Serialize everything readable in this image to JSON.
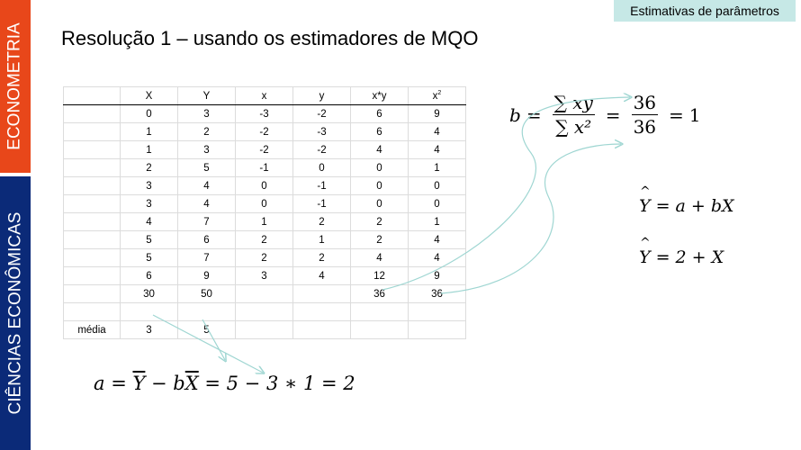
{
  "sidebar": {
    "top_label": "ECONOMETRIA",
    "bottom_label": "CIÊNCIAS ECONÔMICAS"
  },
  "badge": "Estimativas de parâmetros",
  "title": "Resolução 1 – usando os estimadores de MQO",
  "table": {
    "headers": [
      "",
      "X",
      "Y",
      "x",
      "y",
      "x*y",
      "x"
    ],
    "header_superscript": "2",
    "rows": [
      [
        "",
        "0",
        "3",
        "-3",
        "-2",
        "6",
        "9"
      ],
      [
        "",
        "1",
        "2",
        "-2",
        "-3",
        "6",
        "4"
      ],
      [
        "",
        "1",
        "3",
        "-2",
        "-2",
        "4",
        "4"
      ],
      [
        "",
        "2",
        "5",
        "-1",
        "0",
        "0",
        "1"
      ],
      [
        "",
        "3",
        "4",
        "0",
        "-1",
        "0",
        "0"
      ],
      [
        "",
        "3",
        "4",
        "0",
        "-1",
        "0",
        "0"
      ],
      [
        "",
        "4",
        "7",
        "1",
        "2",
        "2",
        "1"
      ],
      [
        "",
        "5",
        "6",
        "2",
        "1",
        "2",
        "4"
      ],
      [
        "",
        "5",
        "7",
        "2",
        "2",
        "4",
        "4"
      ],
      [
        "",
        "6",
        "9",
        "3",
        "4",
        "12",
        "9"
      ]
    ],
    "totals": [
      "",
      "30",
      "50",
      "",
      "",
      "36",
      "36"
    ],
    "blank": [
      "",
      "",
      "",
      "",
      "",
      "",
      ""
    ],
    "media": [
      "média",
      "3",
      "5",
      "",
      "",
      "",
      ""
    ]
  },
  "formulas": {
    "b": {
      "lhs": "b",
      "eq": "=",
      "num1": "∑ xy",
      "den1": "∑ x²",
      "num2": "36",
      "den2": "36",
      "result": "1"
    },
    "yhat1": {
      "hat": "Y",
      "rest": "= a + bX"
    },
    "yhat2": {
      "hat": "Y",
      "rest": "= 2 + X"
    },
    "a": {
      "lhs": "a =",
      "ybar": "Y",
      "mid": " − b",
      "xbar": "X",
      "rest": " = 5 − 3 ∗ 1 = 2"
    }
  },
  "colors": {
    "red": "#e8471a",
    "blue": "#0b2a78",
    "badge": "#c6e8e6",
    "arrow": "#9fd6d2"
  }
}
